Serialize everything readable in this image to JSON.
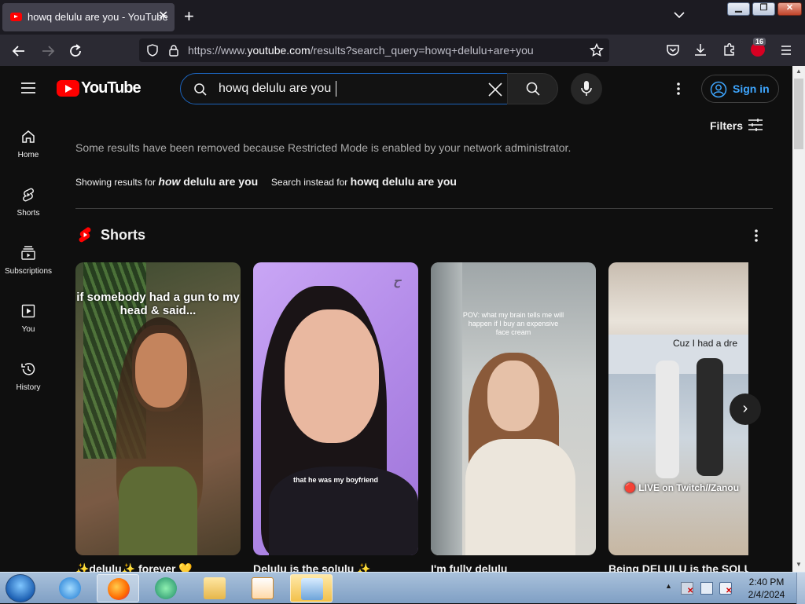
{
  "browser": {
    "tab_title": "howq delulu are you - YouTube",
    "tab_close": "✕",
    "new_tab": "+",
    "url_prefix": "https://www.",
    "url_domain": "youtube.com",
    "url_path": "/results?search_query=howq+delulu+are+you",
    "extensions_badge": "16",
    "window_buttons": {
      "minimize": "▁",
      "maximize": "❐",
      "close": "✕"
    }
  },
  "youtube": {
    "logo_text": "YouTube",
    "search_query": "howq delulu are you",
    "sign_in": "Sign in",
    "sidebar": [
      {
        "label": "Home",
        "icon": "home-icon"
      },
      {
        "label": "Shorts",
        "icon": "shorts-icon"
      },
      {
        "label": "Subscriptions",
        "icon": "subscriptions-icon"
      },
      {
        "label": "You",
        "icon": "you-icon"
      },
      {
        "label": "History",
        "icon": "history-icon"
      }
    ],
    "filters": "Filters",
    "restricted_notice": "Some results have been removed because Restricted Mode is enabled by your network administrator.",
    "showing_prefix": "Showing results for",
    "showing_corrected_italic": "how",
    "showing_corrected_rest": " delulu are you",
    "search_instead_prefix": "Search instead for",
    "search_instead_query": "howq delulu are you",
    "shorts_heading": "Shorts",
    "shorts": [
      {
        "title": "✨delulu✨ forever 💛",
        "overlay": "if somebody had a gun to my head & said..."
      },
      {
        "title": "Delulu is the solulu ✨",
        "overlay": "that he was my boyfriend"
      },
      {
        "title": "I'm fully delulu",
        "overlay": "POV: what my brain tells me will happen if I buy an expensive face cream"
      },
      {
        "title": "Being DELULU is the SOLULU",
        "overlay_top": "Cuz I had a dre",
        "overlay_bottom": "🔴 LIVE on Twitch//Zanou"
      }
    ],
    "next_arrow": "›"
  },
  "taskbar": {
    "time": "2:40 PM",
    "date": "2/4/2024"
  },
  "colors": {
    "youtube_red": "#ff0000",
    "link_blue": "#3ea6ff",
    "background": "#0f0f0f"
  }
}
